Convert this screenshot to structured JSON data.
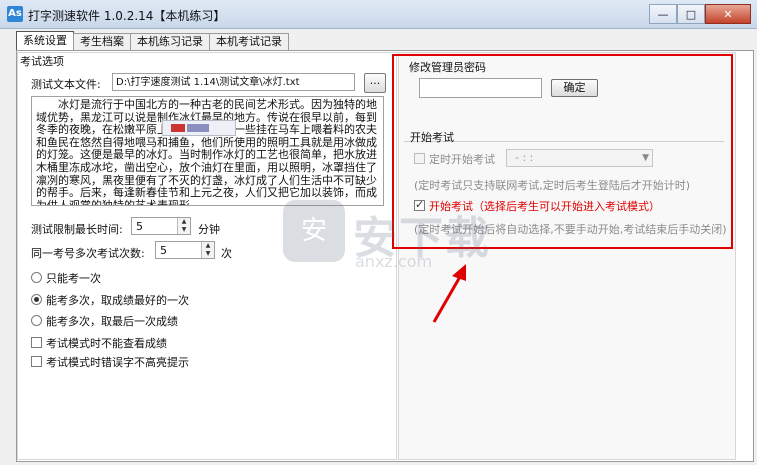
{
  "window": {
    "title": "打字测速软件 1.0.2.14【本机练习】",
    "app_icon": "As",
    "minimize": "—",
    "maximize": "□",
    "close": "✕"
  },
  "tabs": [
    {
      "label": "系统设置",
      "active": true
    },
    {
      "label": "考生档案",
      "active": false
    },
    {
      "label": "本机练习记录",
      "active": false
    },
    {
      "label": "本机考试记录",
      "active": false
    }
  ],
  "left": {
    "section_title": "考试选项",
    "test_file_label": "测试文本文件:",
    "test_file_value": "D:\\打字速度测试 1.14\\测试文章\\冰灯.txt",
    "browse_label": "...",
    "sample_text": "冰灯是流行于中国北方的一种古老的民间艺术形式。因为独特的地域优势，黑龙江可以说是制作冰灯最早的地方。传说在很早以前，每到冬季的夜晚，在松嫩平原上，人们会看到一些挂在马车上喂着料的农夫和鱼民在悠然自得地喂马和捕鱼，他们所使用的照明工具就是用冰做成的灯笼。这便是最早的冰灯。当时制作冰灯的工艺也很简单，把水放进木桶里冻成冰坨，凿出空心，放个油灯在里面，用以照明，冰罩挡住了凛冽的寒风，黑夜里便有了不灭的灯盏，冰灯成了人们生活中不可缺少的帮手。后来，每逢新春佳节和上元之夜，人们又把它加以装饰，而成为供人观赏的独特的艺术表现形",
    "time_limit_label": "测试限制最长时间:",
    "time_limit_value": "5",
    "time_limit_unit": "分钟",
    "multi_times_label": "同一考号多次考试次数:",
    "multi_times_value": "5",
    "multi_times_unit": "次",
    "radio_options": [
      {
        "label": "只能考一次",
        "checked": false
      },
      {
        "label": "能考多次，取成绩最好的一次",
        "checked": true
      },
      {
        "label": "能考多次，取最后一次成绩",
        "checked": false
      }
    ],
    "checkboxes": [
      {
        "label": "考试模式时不能查看成绩",
        "checked": false
      },
      {
        "label": "考试模式时错误字不高亮提示",
        "checked": false
      }
    ]
  },
  "right": {
    "password_title": "修改管理员密码",
    "password_value": "",
    "confirm_label": "确定",
    "start_exam_title": "开始考试",
    "timed_start_label": "定时开始考试",
    "timed_start_value": "-  :  :",
    "timed_note": "(定时考试只支持联网考试,定时后考生登陆后才开始计时)",
    "start_exam_label": "开始考试（选择后考生可以开始进入考试模式）",
    "start_exam_checked": true,
    "start_exam_note": "(定时考试开始后将自动选择,不要手动开始,考试结束后手动关闭)"
  },
  "watermark": {
    "text": "安下载",
    "sub": "anxz.com",
    "shield": "安"
  },
  "colors": {
    "highlight_red": "#e00000",
    "disabled_gray": "#8c8c8c"
  }
}
